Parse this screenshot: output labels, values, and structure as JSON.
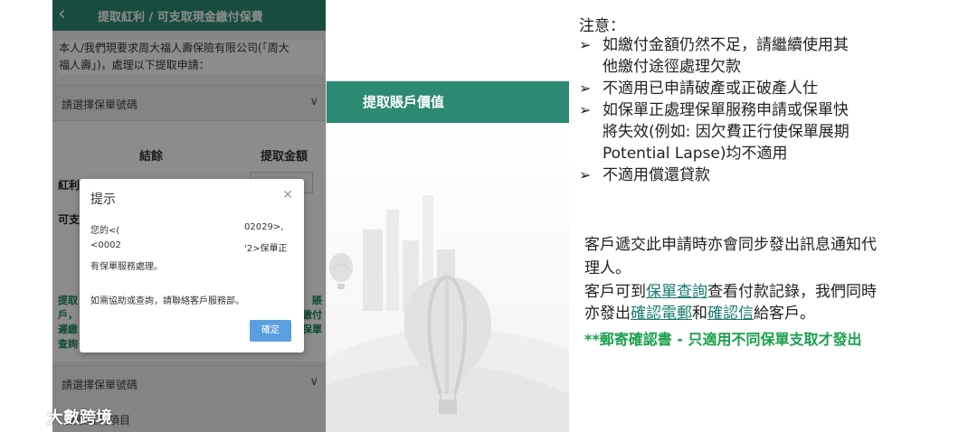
{
  "left_app": {
    "header_title": "提取紅利 / 可支取現金繳付保費",
    "intro_line1": "本人/我們現要求周大福人壽保險有限公司(「周大",
    "intro_line2": "福人壽」)，處理以下提取申請：",
    "select_placeholder": "請選擇保單號碼",
    "table_header_balance": "結餘",
    "table_header_amount": "提取金額",
    "row1_label": "紅利",
    "row2_label": "可支",
    "note_line1_left": "提取",
    "note_line1_right": "賬",
    "note_line2_left": "戶，",
    "note_line2_right": "繳付",
    "note_line3_left": "遲繳",
    "note_line3_right": "保單",
    "note_line4_left": "查詢",
    "select2_placeholder": "請選擇保單號碼",
    "bottom_label": "提取紅利項目"
  },
  "dialog": {
    "title": "提示",
    "line1_left": "您的<(",
    "line1_right": "02029>,",
    "line2_left": "<0002",
    "line2_right": "'2>保單正",
    "line3": "有保單服務處理。",
    "line4": "如需協助或查詢，請聯絡客戶服務部。",
    "ok_label": "確定"
  },
  "middle_app": {
    "header_title": "提取賬戶價值"
  },
  "notes": {
    "title": "注意：",
    "bullets": [
      "如繳付金額仍然不足，請繼續使用其",
      "他繳付途徑處理欠款",
      "不適用已申請破產或正破產人仕",
      "如保單正處理保單服務申請或保單快",
      "將失效(例如: 因欠費正行使保單展期",
      "Potential Lapse)均不適用",
      "不適用償還貸款"
    ],
    "para1_line1": "客戶遞交此申請時亦會同步發出訊息通知代",
    "para1_line2": "理人。",
    "para2_part1": "客戶可到",
    "para2_link1": "保單查詢",
    "para2_part2": "查看付款記錄，我們同時",
    "para2_part3": "亦發出",
    "para2_link2": "確認電郵",
    "para2_part4": "和",
    "para2_link3": "確認信",
    "para2_part5": "給客戶。",
    "green_note": "**郵寄確認書 - 只適用不同保單支取才發出"
  },
  "watermark": {
    "text": "大數跨境"
  },
  "colors": {
    "brand_green": "#2c8a72",
    "note_green": "#19a04b",
    "link_teal": "#1a7c6e",
    "button_blue": "#5aa0e0"
  }
}
